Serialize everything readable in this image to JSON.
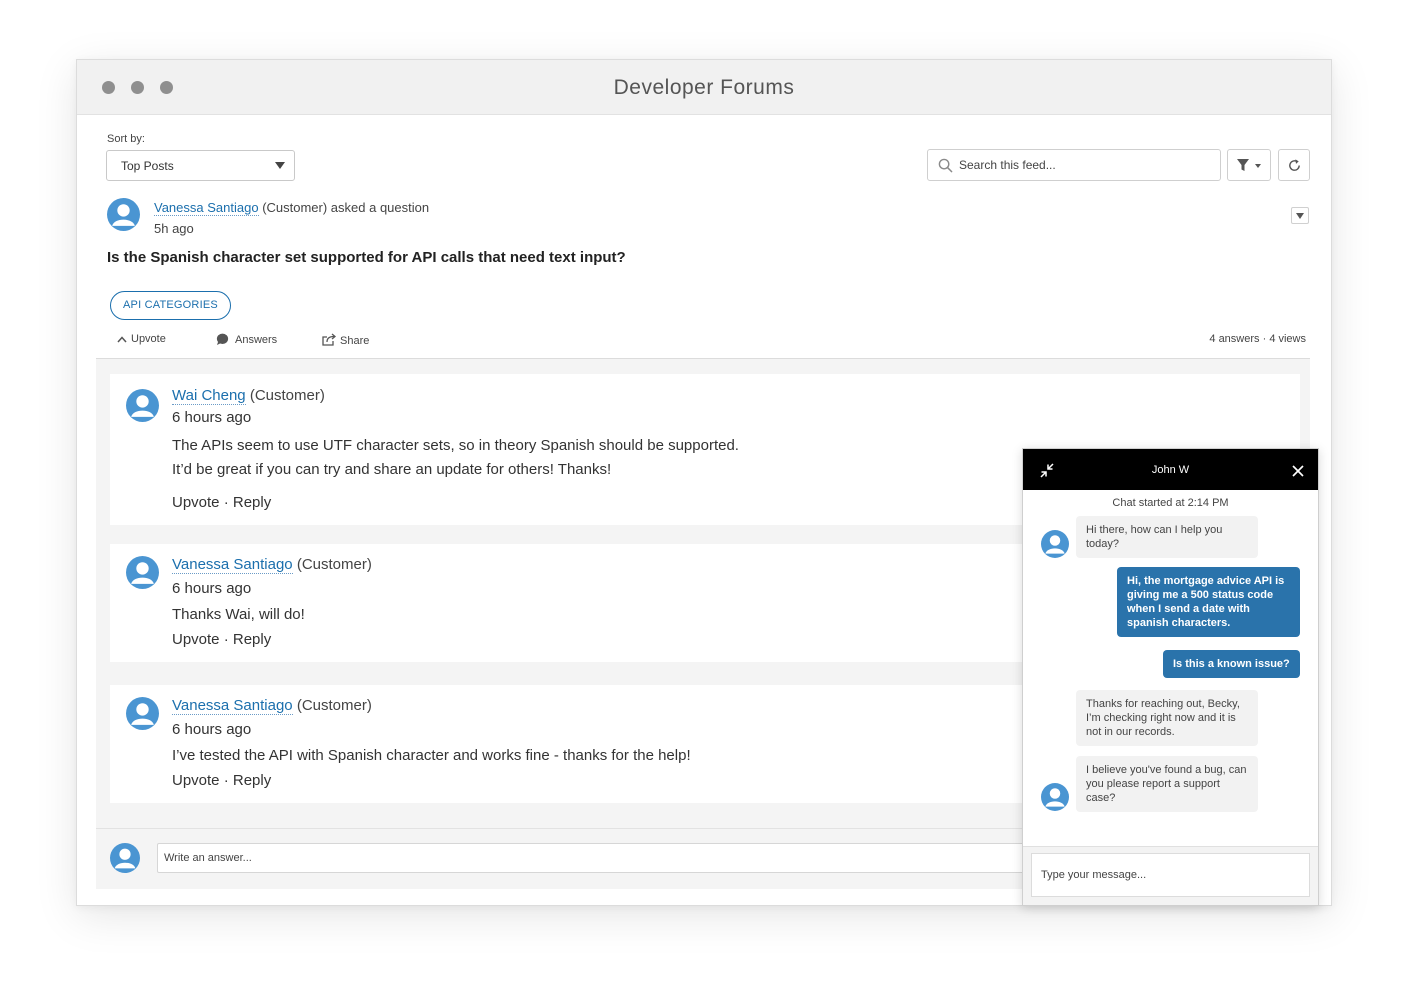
{
  "window": {
    "title": "Developer Forums"
  },
  "toolbar": {
    "sort_label": "Sort by:",
    "sort_value": "Top Posts",
    "search_placeholder": "Search this feed..."
  },
  "post": {
    "author": "Vanessa Santiago",
    "author_role": "(Customer) asked a question",
    "time": "5h ago",
    "question": "Is the Spanish character set supported for API calls that need text input?",
    "topic": "API CATEGORIES",
    "actions": {
      "upvote": "Upvote",
      "answers": "Answers",
      "share": "Share"
    },
    "stats": {
      "answers": "4 answers",
      "views": "· 4 views"
    }
  },
  "answers": [
    {
      "author": "Wai Cheng",
      "role": "(Customer)",
      "time": "6 hours ago",
      "lines": [
        "The APIs seem to use UTF character sets, so in theory Spanish should be supported.",
        "It’d be great if you can try and share an update for others! Thanks!"
      ],
      "upvote": "Upvote",
      "reply": "· Reply"
    },
    {
      "author": "Vanessa Santiago",
      "role": "(Customer)",
      "time": "6 hours ago",
      "lines": [
        "Thanks Wai, will do!"
      ],
      "upvote": "Upvote",
      "reply": "· Reply"
    },
    {
      "author": "Vanessa Santiago",
      "role": "(Customer)",
      "time": "6 hours ago",
      "lines": [
        "I’ve tested the API with Spanish character and works fine - thanks for the help!"
      ],
      "upvote": "Upvote",
      "reply": "· Reply"
    }
  ],
  "composer": {
    "placeholder": "Write an answer..."
  },
  "chat": {
    "agent": "John W",
    "started": "Chat started at 2:14 PM",
    "messages": [
      {
        "from": "agent",
        "text": "Hi there, how can I help you today?"
      },
      {
        "from": "user",
        "text": "Hi, the mortgage advice API is giving me a 500 status code when I send a date with spanish characters."
      },
      {
        "from": "user",
        "text": "Is this a known issue?"
      },
      {
        "from": "agent",
        "text": "Thanks for reaching out, Becky, I’m checking right now and it is not in our records."
      },
      {
        "from": "agent",
        "text": "I believe you've found a bug, can you please report a support case?"
      }
    ],
    "input_placeholder": "Type your message..."
  },
  "icons": {
    "avatar": "user-avatar-icon",
    "search": "search-icon",
    "filter": "filter-icon",
    "refresh": "refresh-icon",
    "minimize": "minimize-icon",
    "close": "close-icon"
  },
  "colors": {
    "accent": "#1b6fad",
    "avatar": "#4a95d2",
    "chat_out": "#2a73ab",
    "chat_header": "#000000"
  }
}
